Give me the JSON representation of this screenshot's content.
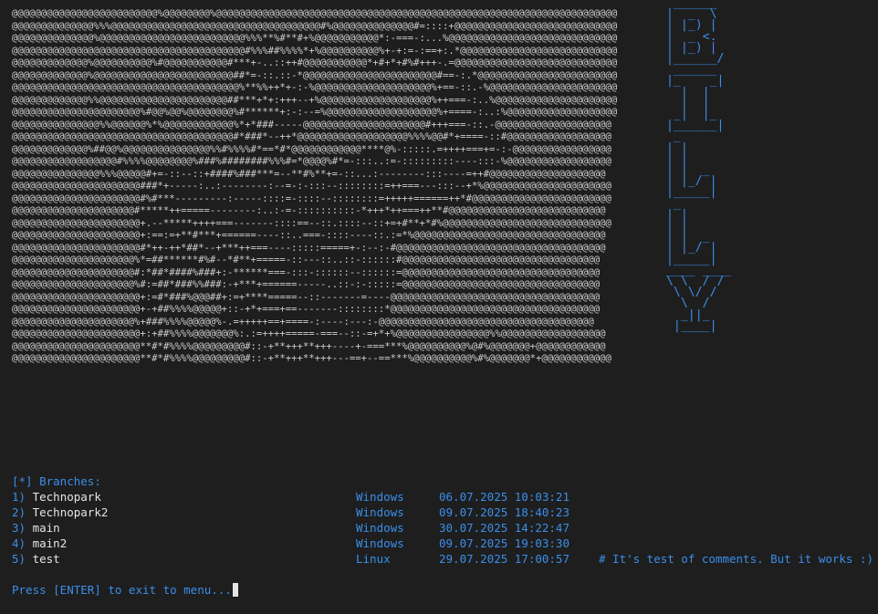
{
  "ascii_art": [
    "@@@@@@@@@@@@@@@@@@@@@@@@@%@@@@@@@@%@@@@@@@@@@@@@@@@@@@@@@@@@@@@@@@@@@@@@@@@@@@@@@@@@@@@@@@@@@@@@@@@@@@@@",
    "@@@@@@@@@@@@@@%%%@@@@@@@@@@@@@@@@@@@@@@@@@@@@@@@@@@@@#%@@@@@@@@@@@@@@#=::::+@@@@@@@@@@@@@@@@@@@@@@@@@@@@",
    "@@@@@@@@@@@@@@%@@@@@@@@@@@@@@@@@@@@@@@@@%%%**%#**#+%@@@@@@@@@@@*:-===-:...%@@@@@@@@@@@@@@@@@@@@@@@@@@@@@",
    "@@@@@@@@@@@@@@@@@@@@@@@@@@@@@@@@@@@@@@@@#%%%##%%%%*+%@@@@@@@@@@%+-+:=-:==+:.*@@@@@@@@@@@@@@@@@@@@@@@@@@@",
    "@@@@@@@@@@@@@%@@@@@@@@@@%#@@@@@@@@@@@#***+-..::++#@@@@@@@@@@@*+#+*+#%#+++-.=@@@@@@@@@@@@@@@@@@@@@@@@@@@@",
    "@@@@@@@@@@@@@%@@@@@@@@@@@@@@@@@@@@@@@@##*=-::.::-*@@@@@@@@@@@@@@@@@@@@@@@#==-:.*@@@@@@@@@@@@@@@@@@@@@@@@",
    "@@@@@@@@@@@@@@@@@@@@@@@@@@@@@@@@@@@@@@@%**%%++*+-:-%@@@@@@@@@@@@@@@@@@@@%+==-::.-%@@@@@@@@@@@@@@@@@@@@@@",
    "@@@@@@@@@@@@@%%@@@@@@@@@@@@@@@@@@@@@@##***+*+:+++--+%@@@@@@@@@@@@@@@@@@@%++===-:..%@@@@@@@@@@@@@@@@@@@@@",
    "@@@@@@@@@@@@@@@@@@@@@@%#@@%@@%@@@@@@@@%#******+:-:--=%@@@@@@@@@@@@@@@@@@@%+====-:..:%@@@@@@@@@@@@@@@@@@@",
    "@@@@@@@@@@@@@@@%%@@@@@@%*%@@@@@@@@@@@@%*+*###-----@@@@@@@@@@@@@@@@@@@@@#+++===-::.-@@@@@@@@@@@@@@@@@@@@",
    "@@@@@@@@@@@@@@@@@@@@@@@@@@@@@@@@@@@@@@#*###*--++*@@@@@@@@@@@@@@@@@@@%%%%@@#*+====-::#@@@@@@@@@@@@@@@@@@",
    "@@@@@@@@@@@@@%##@@%@@@@@@@@@@@@@@@%%#%%%%#*==*#*@@@@@@@@@@@@****@%-:::::.=++++===+=-:-@@@@@@@@@@@@@@@@@",
    "@@@@@@@@@@@@@@@@@@#%%%%@@@@@@@@%###%########%%%#=*@@@@%#*=-:::..:=-:::::::::----:::-%@@@@@@@@@@@@@@@@@@",
    "@@@@@@@@@@@@@@@%%%@@@@@#+=-::--::+####%###***=--**#%**+=-::...:--------:::----=++#@@@@@@@@@@@@@@@@@@@@",
    "@@@@@@@@@@@@@@@@@@@@@@###*+-----:..:--------:--=-:-:::--::::::::=++===---:::--+*%@@@@@@@@@@@@@@@@@@@@@@",
    "@@@@@@@@@@@@@@@@@@@@@@#%#***---------:-----::::=-::::--::::::::=+++++======++*#@@@@@@@@@@@@@@@@@@@@@@@@",
    "@@@@@@@@@@@@@@@@@@@@@#*****++=====--------:..:-=-::::::::::-*+++*++===++**#@@@@@@@@@@@@@@@@@@@@@@@@@@@",
    "@@@@@@@@@@@@@@@@@@@@@@+.--*****++++===-------::::==--::.::::--::+=+#**+*#%@@@@@@@@@@@@@@@@@@@@@@@@@@@@@",
    "@@@@@@@@@@@@@@@@@@@@@@+:==:=+**#***+======----::..===-::::----::.:=*%@@@@@@@@@@@@@@@@@@@@@@@@@@@@@@@@@",
    "@@@@@@@@@@@@@@@@@@@@@@#*++-++*##*--+***++===----:::::=====+-:--:-#@@@@@@@@@@@@@@@@@@@@@@@@@@@@@@@@@@@@",
    "@@@@@@@@@@@@@@@@@@@@@%*=##******#%#--*#**+=====-::---::..::-::::::#@@@@@@@@@@@@@@@@@@@@@@@@@@@@@@@@@@",
    "@@@@@@@@@@@@@@@@@@@@@#:*##*####%###+:-******===-:::-::::::--::::::=@@@@@@@@@@@@@@@@@@@@@@@@@@@@@@@@@@",
    "@@@@@@@@@@@@@@@@@@@@@%#:=##*###%%###:-+***+======-----..::-:-:::::=@@@@@@@@@@@@@@@@@@@@@@@@@@@@@@@@@@",
    "@@@@@@@@@@@@@@@@@@@@@@+:=#*###%@@@##+:=+****=====--::-------=----@@@@@@@@@@@@@@@@@@@@@@@@@@@@@@@@@@@@",
    "@@@@@@@@@@@@@@@@@@@@@@+-+##%%%%@@@@@+::-+*+===+==-------::::::::*@@@@@@@@@@@@@@@@@@@@@@@@@@@@@@@@@@@@",
    "@@@@@@@@@@@@@@@@@@@@@%+###%%%%@@@@@%-.=+++++==+====-:----:---:-@@@@@@@@@@@@@@@@@@@@@@@@@@@@@@@@@@@@@",
    "@@@@@@@@@@@@@@@@@@@@@@+:+##%%%%@@@@@@@%:.:=++++=====-===--::-=+*+%@@@@@@@@@@@@@@@@%%@@@@@@@@@@@@@@@@@@",
    "@@@@@@@@@@@@@@@@@@@@@@**#*#%%%%@@@@@@@@@#::-+**+++**+++----+-===***%@@@@@@@@@@%@#%@@@@@@@+@@@@@@@@@@@@",
    "@@@@@@@@@@@@@@@@@@@@@@**#*#%%%%@@@@@@@@@#::-+**+++**+++---==+--==***%@@@@@@@@@@%#%@@@@@@@*+@@@@@@@@@@@@"
  ],
  "logo_art": [
    "  ______   ",
    " |  _  \\  ",
    " | |_) |  ",
    " |  _ <.  ",
    " | |_) |  ",
    " |______/ ",
    "  ______  ",
    " |_    _| ",
    "   |  |   ",
    "   |  |   ",
    "  _|  |_  ",
    " |______| ",
    "  _       ",
    " | |      ",
    " | |      ",
    " | |  _   ",
    " | |_/ |  ",
    " |_____|  ",
    "  _       ",
    " | |      ",
    " | |      ",
    " | |  _   ",
    " | |_/ |  ",
    " |_____|  ",
    " ____ ____",
    " \\ \\  / /",
    "  \\ \\/ / ",
    "   \\  /  ",
    "   _||_   ",
    "  |____|  "
  ],
  "branches_header": "[*] Branches:",
  "branches": [
    {
      "num": "1)",
      "name": "Technopark",
      "os": "Windows",
      "datetime": "06.07.2025 10:03:21",
      "comment": ""
    },
    {
      "num": "2)",
      "name": "Technopark2",
      "os": "Windows",
      "datetime": "09.07.2025 18:40:23",
      "comment": ""
    },
    {
      "num": "3)",
      "name": "main",
      "os": "Windows",
      "datetime": "30.07.2025 14:22:47",
      "comment": ""
    },
    {
      "num": "4)",
      "name": "main2",
      "os": "Windows",
      "datetime": "09.07.2025 19:03:30",
      "comment": ""
    },
    {
      "num": "5)",
      "name": "test",
      "os": "Linux",
      "datetime": "29.07.2025 17:00:57",
      "comment": "# It's test of comments. But it works :)"
    }
  ],
  "prompt": "Press [ENTER] to exit to menu...",
  "colors": {
    "background": "#1e1e1e",
    "accent_blue": "#3b8eea",
    "text": "#e5e5e5",
    "ascii": "#cccccc"
  }
}
